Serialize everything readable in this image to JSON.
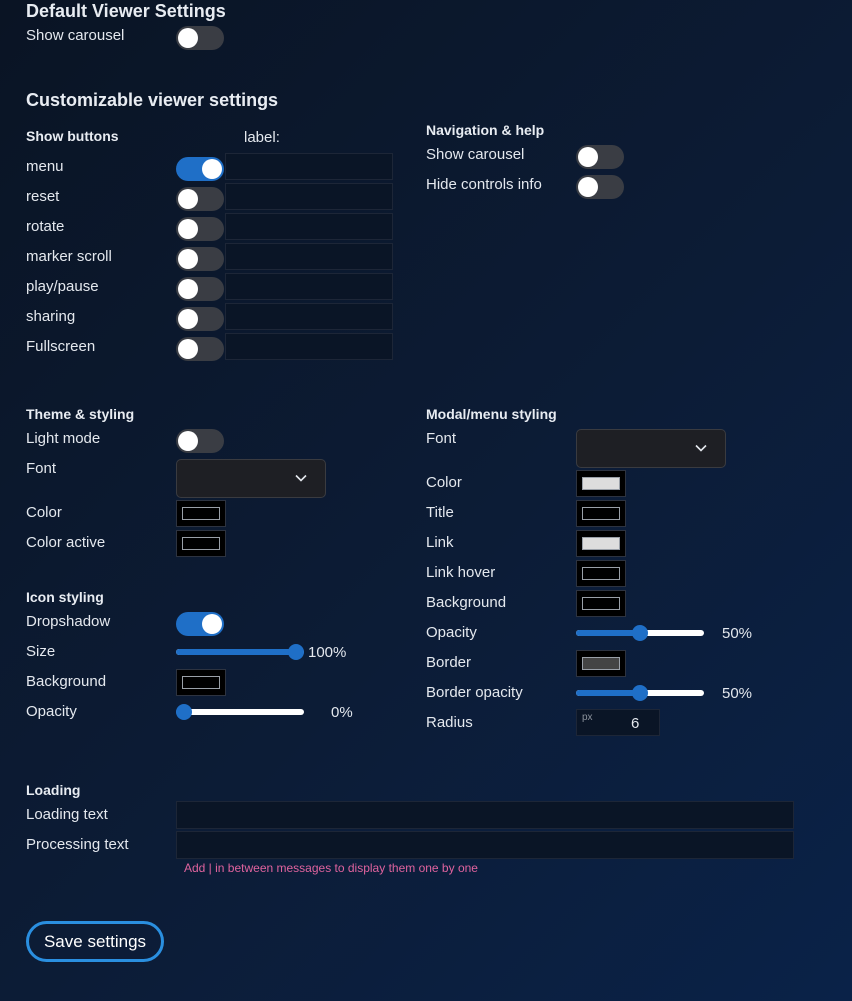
{
  "default_section": {
    "title": "Default Viewer Settings",
    "show_carousel_label": "Show carousel",
    "show_carousel_on": false
  },
  "custom_section": {
    "title": "Customizable viewer settings"
  },
  "show_buttons": {
    "title": "Show buttons",
    "label_header": "label:",
    "items": [
      {
        "label": "menu",
        "on": true,
        "value": ""
      },
      {
        "label": "reset",
        "on": false,
        "value": ""
      },
      {
        "label": "rotate",
        "on": false,
        "value": ""
      },
      {
        "label": "marker scroll",
        "on": false,
        "value": ""
      },
      {
        "label": "play/pause",
        "on": false,
        "value": ""
      },
      {
        "label": "sharing",
        "on": false,
        "value": ""
      },
      {
        "label": "Fullscreen",
        "on": false,
        "value": ""
      }
    ]
  },
  "navigation": {
    "title": "Navigation & help",
    "items": [
      {
        "label": "Show carousel",
        "on": false
      },
      {
        "label": "Hide controls info",
        "on": false
      }
    ]
  },
  "theme": {
    "title": "Theme & styling",
    "light_mode_label": "Light mode",
    "light_mode_on": false,
    "font_label": "Font",
    "font_value": "",
    "color_label": "Color",
    "color_value": "#000000",
    "color_active_label": "Color active",
    "color_active_value": "#000000"
  },
  "icon_styling": {
    "title": "Icon styling",
    "dropshadow_label": "Dropshadow",
    "dropshadow_on": true,
    "size_label": "Size",
    "size_percent": 100,
    "size_display": "100%",
    "background_label": "Background",
    "background_value": "#000000",
    "opacity_label": "Opacity",
    "opacity_percent": 0,
    "opacity_display": "0%"
  },
  "modal": {
    "title": "Modal/menu styling",
    "font_label": "Font",
    "font_value": "",
    "color_label": "Color",
    "color_value": "#dddddd",
    "title_label": "Title",
    "title_value": "#000000",
    "link_label": "Link",
    "link_value": "#dddddd",
    "link_hover_label": "Link hover",
    "link_hover_value": "#000000",
    "background_label": "Background",
    "background_value": "#000000",
    "opacity_label": "Opacity",
    "opacity_percent": 50,
    "opacity_display": "50%",
    "border_label": "Border",
    "border_value": "#444444",
    "border_opacity_label": "Border opacity",
    "border_opacity_percent": 50,
    "border_opacity_display": "50%",
    "radius_label": "Radius",
    "radius_unit": "px",
    "radius_value": "6"
  },
  "loading": {
    "title": "Loading",
    "loading_text_label": "Loading text",
    "loading_text_value": "",
    "processing_text_label": "Processing text",
    "processing_text_value": "",
    "hint": "Add | in between messages to display them one by one"
  },
  "save_label": "Save settings",
  "colors": {
    "accent": "#1f6fc7",
    "save_border": "#2a8fe0",
    "hint": "#e0639e"
  }
}
